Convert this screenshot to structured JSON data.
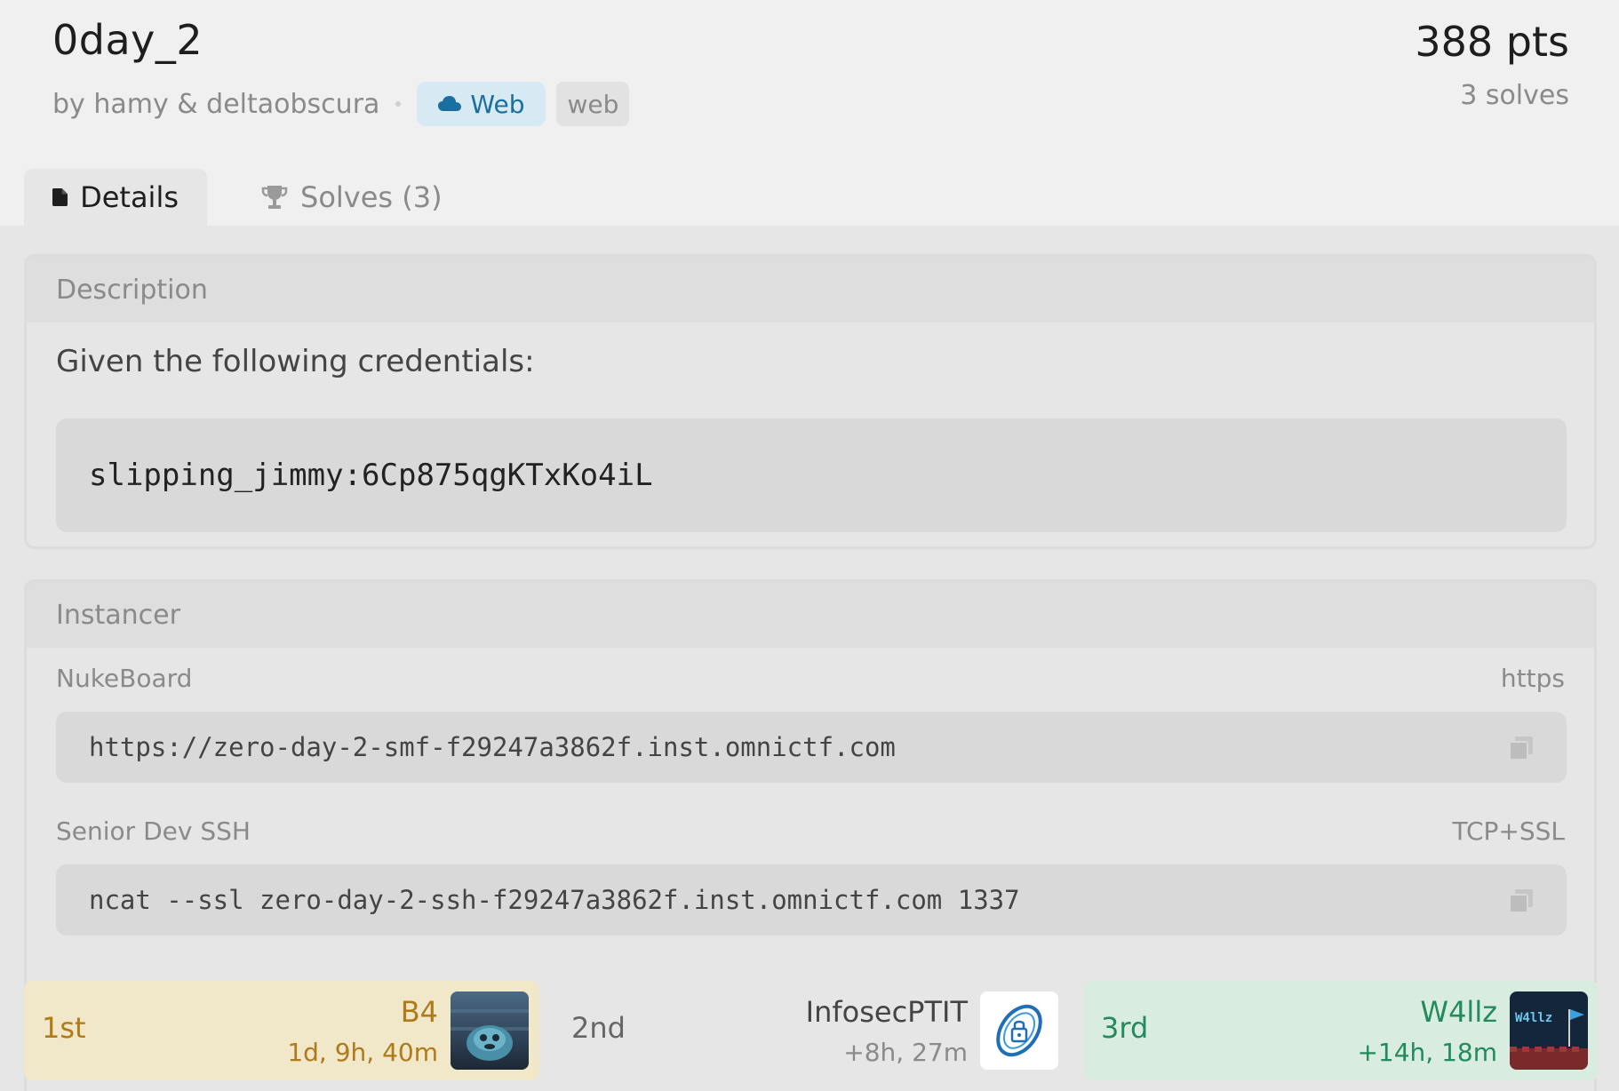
{
  "challenge": {
    "title": "0day_2",
    "authors": "by hamy & deltaobscura",
    "category": "Web",
    "tag": "web",
    "points": "388 pts",
    "solves": "3 solves"
  },
  "tabs": [
    {
      "label": "Details",
      "icon": "document-icon",
      "active": true
    },
    {
      "label": "Solves (3)",
      "icon": "trophy-icon",
      "active": false
    }
  ],
  "description": {
    "heading": "Description",
    "text": "Given the following credentials:",
    "credentials": "slipping_jimmy:6Cp875qgKTxKo4iL"
  },
  "instancer": {
    "heading": "Instancer",
    "services": [
      {
        "name": "NukeBoard",
        "protocol": "https",
        "value": "https://zero-day-2-smf-f29247a3862f.inst.omnictf.com"
      },
      {
        "name": "Senior Dev SSH",
        "protocol": "TCP+SSL",
        "value": "ncat --ssl zero-day-2-ssh-f29247a3862f.inst.omnictf.com 1337"
      }
    ]
  },
  "solvers": [
    {
      "rank": "1st",
      "team": "B4",
      "time": "1d, 9h, 40m",
      "color": "#b07a1a"
    },
    {
      "rank": "2nd",
      "team": "InfosecPTIT",
      "time": "+8h, 27m",
      "color": "#666666"
    },
    {
      "rank": "3rd",
      "team": "W4llz",
      "time": "+14h, 18m",
      "color": "#238a5c"
    }
  ],
  "colors": {
    "background": "#f0f0f0",
    "panel": "#e6e6e6",
    "category_bg": "#d7e9f3",
    "category_fg": "#1a6fa0"
  }
}
